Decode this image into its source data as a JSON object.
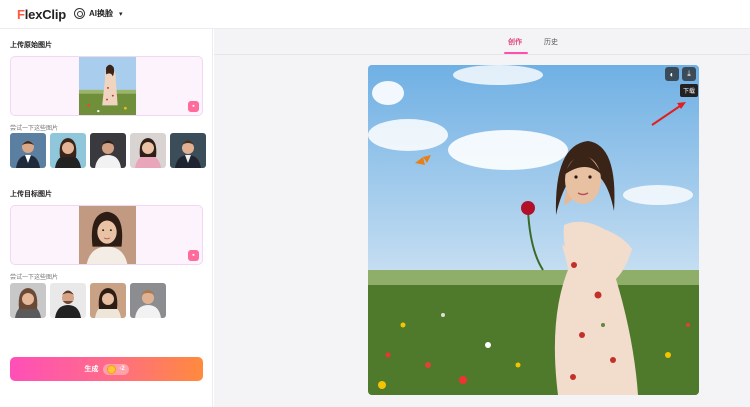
{
  "header": {
    "logo_prefix": "F",
    "logo_rest": "lexClip",
    "tool_name": "AI换脸",
    "tool_icon": "face-swap-icon",
    "dropdown_icon": "chevron-down-icon"
  },
  "left_panel": {
    "original": {
      "title": "上传原始图片",
      "hint": "尝试一下这些图片",
      "thumb_count": 5
    },
    "target": {
      "title": "上传目标图片",
      "hint": "尝试一下这些图片",
      "thumb_count": 4
    },
    "generate": {
      "label": "生成",
      "credit_icon": "coin-icon",
      "credit_cost": "-2"
    }
  },
  "main": {
    "tabs": [
      {
        "label": "创作",
        "active": true
      },
      {
        "label": "历史",
        "active": false
      }
    ],
    "canvas_actions": {
      "compare_icon": "compare-icon",
      "download_icon": "download-icon",
      "download_tooltip": "下载"
    }
  },
  "colors": {
    "brand": "#ff5a3c",
    "accent": "#ff4fa8",
    "generate_gradient": [
      "#ff4fb8",
      "#ff8a3d"
    ]
  }
}
